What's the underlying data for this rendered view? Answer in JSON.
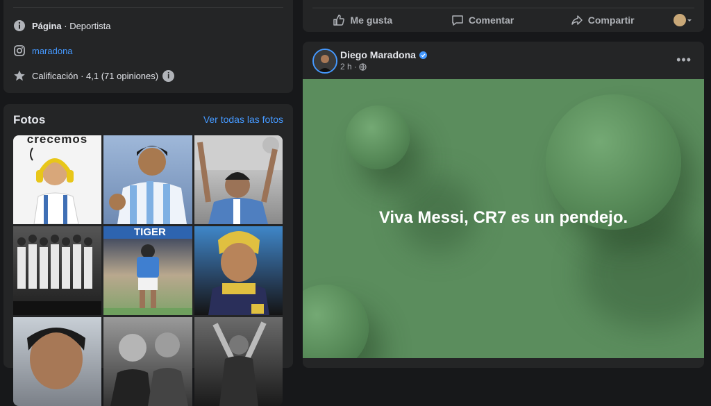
{
  "about": {
    "page_label": "Página",
    "page_category": "· Deportista",
    "instagram": "maradona",
    "rating_text": "Calificación · 4,1 (71 opiniones)",
    "info_glyph": "i"
  },
  "photos": {
    "title": "Fotos",
    "see_all": "Ver todas las fotos",
    "items": [
      {
        "caption": "crecemos"
      },
      {
        "caption": ""
      },
      {
        "caption": ""
      },
      {
        "caption": ""
      },
      {
        "caption": "TIGER"
      },
      {
        "caption": ""
      },
      {
        "caption": ""
      },
      {
        "caption": ""
      },
      {
        "caption": ""
      }
    ]
  },
  "actions": {
    "like": "Me gusta",
    "comment": "Comentar",
    "share": "Compartir"
  },
  "post": {
    "author": "Diego Maradona",
    "time": "2 h ·",
    "more": "•••",
    "text": "Viva Messi, CR7 es un pendejo."
  },
  "colors": {
    "background": "#17181a",
    "card": "#242526",
    "accent": "#4599ff",
    "post_bg": "#5b8d5d"
  },
  "icons": [
    "info-icon",
    "instagram-icon",
    "star-icon",
    "like-icon",
    "comment-icon",
    "share-icon",
    "globe-icon",
    "verified-icon",
    "more-icon"
  ]
}
